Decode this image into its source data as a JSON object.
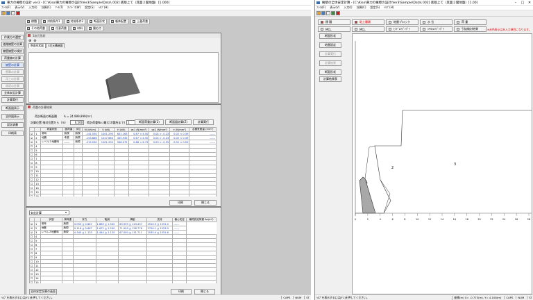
{
  "left": {
    "title": "東力の擁壁の設計  ver3 - [C:\\Kiso\\東力の擁壁の設計\\Ver3\\Sample\\Data\\ 002]  底版上て（其面２層地盤）[1.000]",
    "menus": [
      "ﾌｧｲﾙ(F)",
      "表示(V)",
      "入力(I)",
      "計算(C)",
      "ﾂｰﾙ(T)",
      "ｳｨﾝﾄﾞｳ(W)",
      "設定(S)",
      "ﾍﾙﾌﾟ(H)"
    ],
    "checks": [
      {
        "label": "標題",
        "on": true
      },
      {
        "label": "対前条件1",
        "on": true
      },
      {
        "label": "対前条件2",
        "on": true
      },
      {
        "label": "断面形状",
        "on": true
      },
      {
        "label": "躯体配置",
        "on": true
      },
      {
        "label": "上載荷重",
        "on": true
      }
    ],
    "checks2": [
      {
        "label": "その他荷重",
        "on": true
      },
      {
        "label": "任意荷重",
        "on": true
      },
      {
        "label": "材料",
        "on": true
      },
      {
        "label": "震応点",
        "on": true
      }
    ],
    "sidebar": [
      "作業方の選定",
      "道路擁壁の計算",
      "擁壁擁壁の検討",
      "荷重擁の計算",
      "擁壁の計算",
      "衝撃の計算",
      "浮上の計算",
      "堰堤の計算",
      "全体安定計算"
    ],
    "sidebar_selected": 4,
    "sidebar2": [
      "計算実行",
      "断面図表示",
      "全体図表示",
      "設計調書",
      "印刷表"
    ],
    "view3d_title": "3次元形状",
    "view3d_tabs": [
      "断面形状図",
      "3次元構造図"
    ],
    "calc": {
      "title": "荷重の計算結果",
      "area_label": "荷計断面の断面積",
      "area_value": "A = 24.999,999(m²)",
      "dx_label": "計算位置 指対位置から（m）",
      "dx_value": "0.500",
      "load_label": "荷計荷重No.(最大10箇所まで)",
      "load_value": "1",
      "buttons": [
        "断面荷重計算(2)",
        "断面図計算(Z)",
        "計算実行"
      ],
      "headers": [
        "",
        "",
        "荷重状態",
        "面荷重",
        "水位",
        "M (kN·m)",
        "V (kN)",
        "H (kN)",
        "σc1 (N/mm²)",
        "σc2 (N/mm²)",
        "τ (N/mm²)",
        "必要鉄筋量 (mm²)"
      ],
      "rows": [
        [
          "☑",
          "1",
          "常時",
          "無視",
          "無視",
          "-141.530",
          "1001.290",
          "651.163",
          "0.67 < 4.50",
          "0.04 > -0.23",
          "0.02 < 0.39",
          "------"
        ],
        [
          "☑",
          "2",
          "地震",
          "考慮",
          "無視",
          "-153.886",
          "1027.663",
          "435.935",
          "0.67 < 4.50",
          "0.04 > -0.23",
          "0.02 < 0.39",
          "------"
        ],
        [
          "☑",
          "3",
          "レベル２地震時",
          "------",
          "無視",
          "-215.030",
          "1001.290",
          "946.072",
          "0.68 < 6.75",
          "0.03 > -0.35",
          "0.02 < 0.59",
          "------"
        ]
      ],
      "row_numbers": [
        "4",
        "5",
        "6",
        "7",
        "8",
        "9",
        "10",
        "11",
        "12",
        "13",
        "14",
        "15",
        "16",
        "17",
        "18",
        "19"
      ],
      "print_label": "印刷",
      "close_label": "閉じる"
    },
    "stab": {
      "select_value": "安定計算 ",
      "headers": [
        "",
        "",
        "状態",
        "滑荷重",
        "浮力",
        "転倒",
        "滑動",
        "支持",
        "偏心安定",
        "最終設定荷重 Ao(m²)"
      ],
      "rows": [
        [
          "☑",
          "1",
          "常時",
          "無視",
          "0.093 ≦ 0.667",
          "1.889 ≧ 1.500",
          "69.999 ≦ 123.437",
          "2910.9 ≦ 1551.0",
          "------"
        ],
        [
          "☑",
          "2",
          "地震",
          "無視",
          "0.116 ≦ 0.667",
          "1.672 ≧ 1.200",
          "71.999 ≦ 128.776",
          "2794.1 ≦ 1553.9",
          "------"
        ],
        [
          "☑",
          "3",
          "レベル２地震時",
          "無視",
          "0.345 ≦ 1.133",
          "1.444 ≧ 1.120",
          "67.000 ≦ 131.711",
          "2535.0 ≦ 1551.6",
          "------"
        ]
      ],
      "row_numbers": [
        "4",
        "5",
        "6",
        "7",
        "8",
        "9",
        "10",
        "11",
        "12",
        "13",
        "14",
        "15",
        "16",
        "17",
        "18",
        "19"
      ],
      "bottom_btn": "全体安定計算の画面",
      "print_label": "印刷",
      "close_label": "閉じる"
    },
    "status": {
      "hint": "ﾍﾙﾌﾟを表示するには[F1]を押してください。",
      "caps": "CAPS",
      "num": "NUM",
      "scrl": "ST"
    }
  },
  "right": {
    "title": "擁壁の全体安定計算 - [C:\\Kiso\\東力の擁壁の設計\\Ver3\\Sample\\Data\\ 002]  底版上て（其面２層地盤）[1.00]",
    "menus": [
      "ﾌｧｲﾙ(F)",
      "表示(V)",
      "入力(I)",
      "計算(C)",
      "設定(S)",
      "ﾍﾙﾌﾟ(H)"
    ],
    "tabs1": [
      "標 題",
      "粘土種類",
      "地層ブロック",
      "水 位",
      "荷 重"
    ],
    "tabs2": [
      "MCL",
      "MCL",
      "ﾋﾝﾄﾞﾑﾘﾌﾞﾝｸﾞｲ",
      "ｼﾔﾙｼﾑﾘﾌﾞﾝｸﾞｲ",
      "引抜検討結果"
    ],
    "note": "※赤色表示は未入力項目になります。",
    "sidebar": [
      "断面形状",
      "地層設定",
      "計算実行",
      "計算結果"
    ],
    "sidebar2": [
      "断面形状",
      "計算結果表"
    ],
    "regions": [
      "1",
      "2",
      "3"
    ],
    "x_ticks": [
      "0",
      "2",
      "4",
      "6",
      "8",
      "10",
      "12",
      "14",
      "16",
      "18",
      "20",
      "22",
      "24",
      "26",
      "28"
    ],
    "status": {
      "hint": "ﾍﾙﾌﾟを表示するには[F1]を押してください。",
      "coord": "座標(m)  X= -0.773(m), Y= 4.108(m)",
      "caps": "CAPS",
      "num": "NUM",
      "scrl": "ST"
    }
  }
}
